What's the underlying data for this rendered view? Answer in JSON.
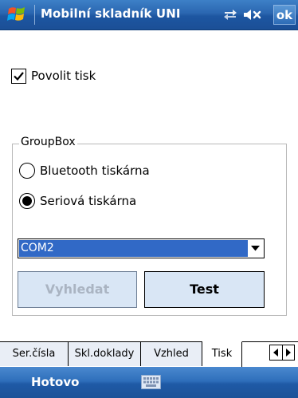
{
  "titlebar": {
    "app_title": "Mobilní skladník UNI",
    "ok_label": "ok"
  },
  "icons": {
    "start": "windows-flag-icon",
    "connectivity": "connectivity-arrows-icon",
    "volume": "speaker-muted-icon",
    "combo_arrow": "chevron-down-icon",
    "keyboard": "keyboard-icon"
  },
  "print_checkbox": {
    "label": "Povolit tisk",
    "checked": true
  },
  "groupbox": {
    "title": "GroupBox",
    "radios": [
      {
        "label": "Bluetooth tiskárna",
        "selected": false
      },
      {
        "label": "Seriová tiskárna",
        "selected": true
      }
    ]
  },
  "port_select": {
    "value": "COM2"
  },
  "buttons": {
    "find_label": "Vyhledat",
    "find_enabled": false,
    "test_label": "Test"
  },
  "tabs": [
    {
      "label": "Ser.čísla",
      "active": false
    },
    {
      "label": "Skl.doklady",
      "active": false
    },
    {
      "label": "Vzhled",
      "active": false
    },
    {
      "label": "Tisk",
      "active": true
    }
  ],
  "menubar": {
    "left_softkey": "Hotovo"
  },
  "colors": {
    "title_bar": "#2a66b0",
    "selection": "#3169c6",
    "button_face": "#d9e6f5",
    "disabled_text": "#aab4c2"
  }
}
